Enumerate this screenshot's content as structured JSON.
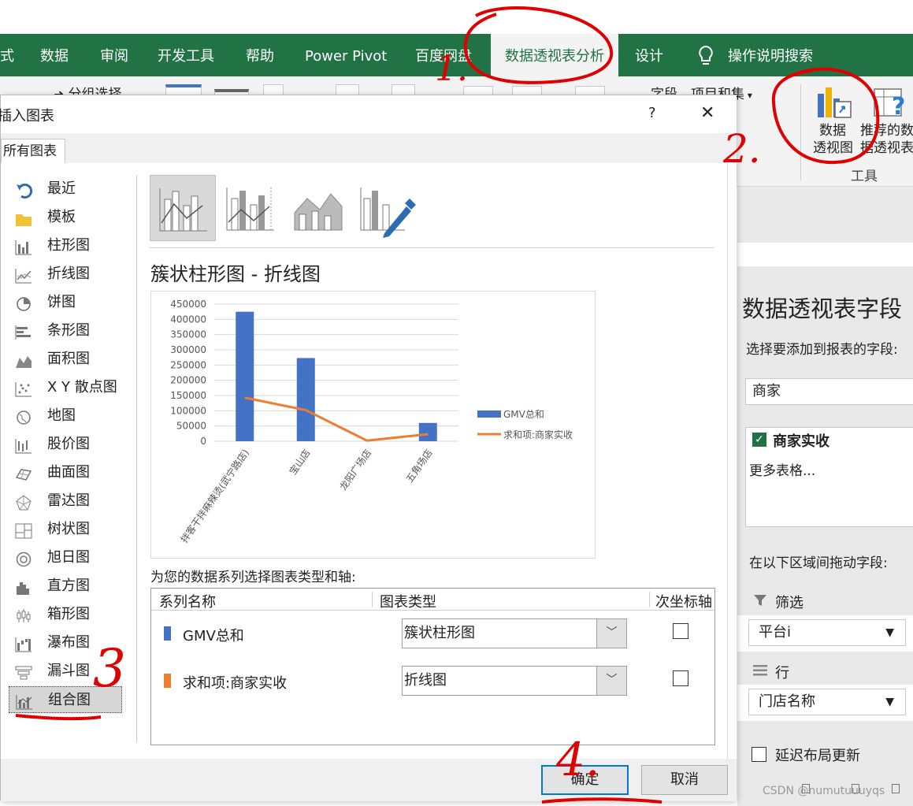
{
  "ribbon": {
    "tabs": [
      "式",
      "数据",
      "审阅",
      "开发工具",
      "帮助",
      "Power Pivot",
      "百度网盘",
      "数据透视表分析",
      "设计",
      "操作说明搜索"
    ],
    "active_tab": "数据透视表分析",
    "group_select": "分组选择",
    "fields_label": "字段、项目和集",
    "pivotchart_label": [
      "数据",
      "透视图"
    ],
    "recommended_label": [
      "推荐的数",
      "据透视表"
    ],
    "group_tools": "工具"
  },
  "dialog": {
    "title": "插入图表",
    "help": "?",
    "close": "✕",
    "tab": "所有图表",
    "categories": [
      "最近",
      "模板",
      "柱形图",
      "折线图",
      "饼图",
      "条形图",
      "面积图",
      "X Y 散点图",
      "地图",
      "股价图",
      "曲面图",
      "雷达图",
      "树状图",
      "旭日图",
      "直方图",
      "箱形图",
      "瀑布图",
      "漏斗图",
      "组合图"
    ],
    "selected_category": "组合图",
    "preview_title": "簇状柱形图 - 折线图",
    "series_prompt": "为您的数据系列选择图表类型和轴:",
    "table_headers": [
      "系列名称",
      "图表类型",
      "次坐标轴"
    ],
    "series_rows": [
      {
        "name": "GMV总和",
        "type": "簇状柱形图",
        "color": "#4472c4",
        "secondary": false
      },
      {
        "name": "求和项:商家实收",
        "type": "折线图",
        "color": "#ed7d31",
        "secondary": false
      }
    ],
    "ok": "确定",
    "cancel": "取消"
  },
  "chart_data": {
    "type": "bar",
    "categories": [
      "拌客干拌麻辣烫(武宁路店)",
      "宝山店",
      "龙阳广场店",
      "五角场店"
    ],
    "series": [
      {
        "name": "GMV总和",
        "type": "bar",
        "color": "#4472c4",
        "values": [
          425000,
          273000,
          0,
          60000
        ]
      },
      {
        "name": "求和项:商家实收",
        "type": "line",
        "color": "#ed7d31",
        "values": [
          143000,
          102000,
          2000,
          23000
        ]
      }
    ],
    "y_ticks": [
      "450000",
      "400000",
      "350000",
      "300000",
      "250000",
      "200000",
      "150000",
      "100000",
      "50000",
      "0"
    ],
    "ylim": [
      0,
      450000
    ],
    "grid": true,
    "legend": "right"
  },
  "right_pane": {
    "title": "数据透视表字段",
    "subtitle": "选择要添加到报表的字段:",
    "search_value": "商家",
    "field_item": "商家实收",
    "more_tables": "更多表格...",
    "drag_prompt": "在以下区域间拖动字段:",
    "filter_label": "筛选",
    "filter_value": "平台i",
    "rows_label": "行",
    "rows_value": "门店名称",
    "defer_label": "延迟布局更新"
  },
  "annotations": {
    "num1": "1.",
    "num2": "2.",
    "num3": "3",
    "num4": "4."
  },
  "watermark": "CSDN @numutuuuyqs"
}
